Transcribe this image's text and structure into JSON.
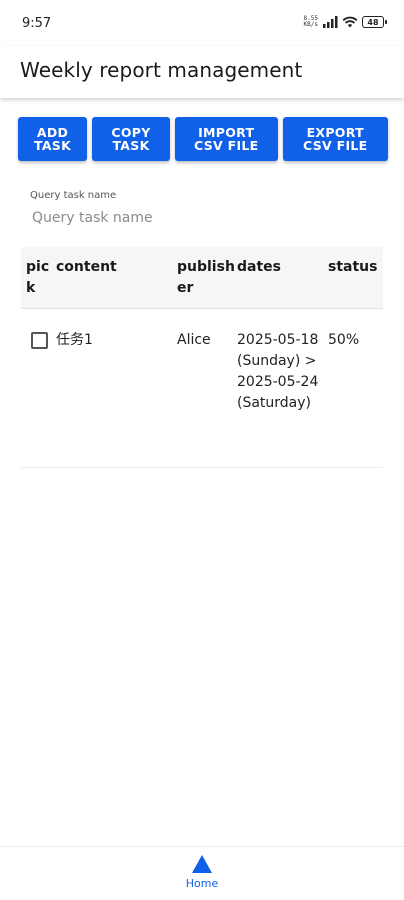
{
  "status_bar": {
    "time": "9:57",
    "net_speed_top": "8.55",
    "net_speed_unit": "KB/s",
    "battery": "48",
    "colors": {
      "text": "#222222"
    }
  },
  "app_bar": {
    "title": "Weekly report management"
  },
  "toolbar": {
    "add_label": "ADD\nTASK",
    "copy_label": "COPY\nTASK",
    "import_label": "IMPORT\nCSV FILE",
    "export_label": "EXPORT\nCSV FILE",
    "accent": "#1060e8"
  },
  "search": {
    "label": "Query task name",
    "placeholder": "Query task name",
    "value": ""
  },
  "table": {
    "columns": [
      "pick",
      "content",
      "publisher",
      "dates",
      "status"
    ],
    "rows": [
      {
        "checked": false,
        "content": "任务1",
        "publisher": "Alice",
        "dates": "2025-05-18(Sunday) > 2025-05-24(Saturday)",
        "status": "50%"
      }
    ]
  },
  "bottom_nav": {
    "items": [
      {
        "label": "Home",
        "icon": "home-triangle-icon",
        "active": true
      }
    ]
  }
}
